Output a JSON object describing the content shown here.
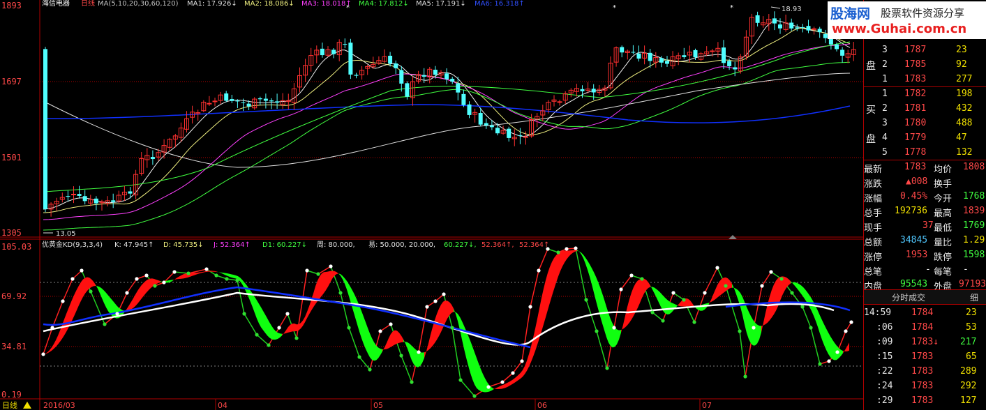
{
  "chart_header": {
    "stock_name": "海信电器",
    "period": "日线",
    "ma_params": "MA(5,10,20,30,60,120)",
    "ma1": "MA1: 17.926↓",
    "ma2": "MA2: 18.086↓",
    "ma3": "MA3: 18.018↑",
    "ma4": "MA4: 17.812↓",
    "ma5": "MA5: 17.191↓",
    "ma6": "MA6: 16.318↑"
  },
  "price_axis": [
    "1893",
    "1697",
    "1501",
    "1305"
  ],
  "indicator_axis": [
    "105.03",
    "69.92",
    "34.81",
    "0.19"
  ],
  "indicator_header": {
    "name": "优黄金KD(9,3,3,4)",
    "k": "K: 47.945↑",
    "d": "D: 45.735↓",
    "j": "J: 52.364↑",
    "d1": "D1: 60.227↓",
    "week": "周: 80.000,",
    "yi": "易: 50.000, 20.000,",
    "v1": "60.227↓,",
    "v2": "52.364↑,",
    "v3": "52.364↑"
  },
  "annotations": {
    "high_label": "18.93",
    "low_label": "13.05"
  },
  "time_axis": {
    "period_button": "日线",
    "labels": [
      "2016/03",
      "04",
      "05",
      "06",
      "07"
    ]
  },
  "logo": {
    "site_cn": "股海网",
    "slogan": "股票软件资源分享",
    "url": "www.Guhai.com.cn"
  },
  "quote_panel": {
    "sell_label": "盘",
    "buy_label_1": "买",
    "buy_label_2": "盘",
    "sell_orders": [
      {
        "level": "3",
        "price": "1787",
        "vol": "23"
      },
      {
        "level": "2",
        "price": "1785",
        "vol": "92"
      },
      {
        "level": "1",
        "price": "1783",
        "vol": "277"
      }
    ],
    "buy_orders": [
      {
        "level": "1",
        "price": "1782",
        "vol": "198"
      },
      {
        "level": "2",
        "price": "1781",
        "vol": "432"
      },
      {
        "level": "3",
        "price": "1780",
        "vol": "488"
      },
      {
        "level": "4",
        "price": "1779",
        "vol": "47"
      },
      {
        "level": "5",
        "price": "1778",
        "vol": "132"
      }
    ],
    "stats": [
      {
        "l1": "最新",
        "v1": "1783",
        "l2": "均价",
        "v2": "1808"
      },
      {
        "l1": "涨跌",
        "v1": "▲008",
        "l2": "换手",
        "v2": ""
      },
      {
        "l1": "涨幅",
        "v1": "0.45%",
        "l2": "今开",
        "v2": "1768"
      },
      {
        "l1": "总手",
        "v1": "192736",
        "l2": "最高",
        "v2": "1839"
      },
      {
        "l1": "现手",
        "v1": "37",
        "l2": "最低",
        "v2": "1769"
      },
      {
        "l1": "总额",
        "v1": "34845",
        "l2": "量比",
        "v2": "1.29"
      },
      {
        "l1": "涨停",
        "v1": "1953",
        "l2": "跌停",
        "v2": "1598"
      },
      {
        "l1": "总笔",
        "v1": "-",
        "l2": "每笔",
        "v2": "-"
      },
      {
        "l1": "内盘",
        "v1": "95543",
        "l2": "外盘",
        "v2": "97193"
      }
    ],
    "ticks_tab": "分时成交",
    "detail_tab": "细",
    "ticks": [
      {
        "time": "14:59",
        "price": "1784",
        "vol": "23"
      },
      {
        "time": ":06",
        "price": "1784",
        "vol": "53"
      },
      {
        "time": ":09",
        "price": "1783↓",
        "vol": "217"
      },
      {
        "time": ":15",
        "price": "1783",
        "vol": "65"
      },
      {
        "time": ":22",
        "price": "1783",
        "vol": "289"
      },
      {
        "time": ":24",
        "price": "1783",
        "vol": "292"
      },
      {
        "time": ":29",
        "price": "1783",
        "vol": "127"
      }
    ]
  },
  "colors": {
    "up": "#ff3030",
    "down": "#50ffff",
    "grid": "#b00000",
    "ma1": "#f0f0f0",
    "ma2": "#f0f080",
    "ma3": "#ff40ff",
    "ma4": "#40ff40",
    "ma5": "#e0e0e0",
    "ma6": "#1030ff"
  }
}
